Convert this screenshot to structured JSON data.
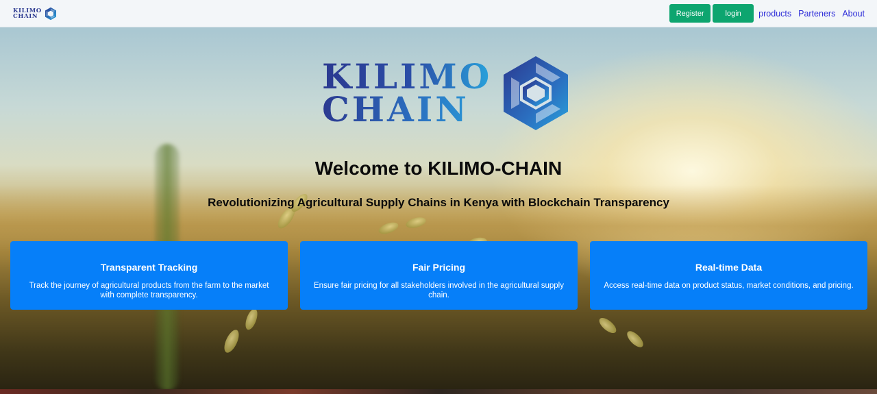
{
  "navbar": {
    "brand_line1": "KILIMO",
    "brand_line2": "CHAIN",
    "register_label": "Register",
    "login_label": "login",
    "links": [
      "products",
      "Parteners",
      "About"
    ]
  },
  "hero": {
    "logo_line1": "KILIMO",
    "logo_line2": "CHAIN",
    "title": "Welcome to KILIMO-CHAIN",
    "subtitle": "Revolutionizing Agricultural Supply Chains in Kenya with Blockchain Transparency"
  },
  "features": [
    {
      "title": "Transparent Tracking",
      "text": "Track the journey of agricultural products from the farm to the market with complete transparency."
    },
    {
      "title": "Fair Pricing",
      "text": "Ensure fair pricing for all stakeholders involved in the agricultural supply chain."
    },
    {
      "title": "Real-time Data",
      "text": "Access real-time data on product status, market conditions, and pricing."
    }
  ],
  "colors": {
    "nav_button": "#0da56f",
    "nav_link": "#2b2bd8",
    "card_bg": "#067ff9",
    "brand_dark": "#2b3990",
    "brand_light": "#29a3dc"
  },
  "icons": {
    "logo_mark": "hexagon-chain-icon"
  }
}
